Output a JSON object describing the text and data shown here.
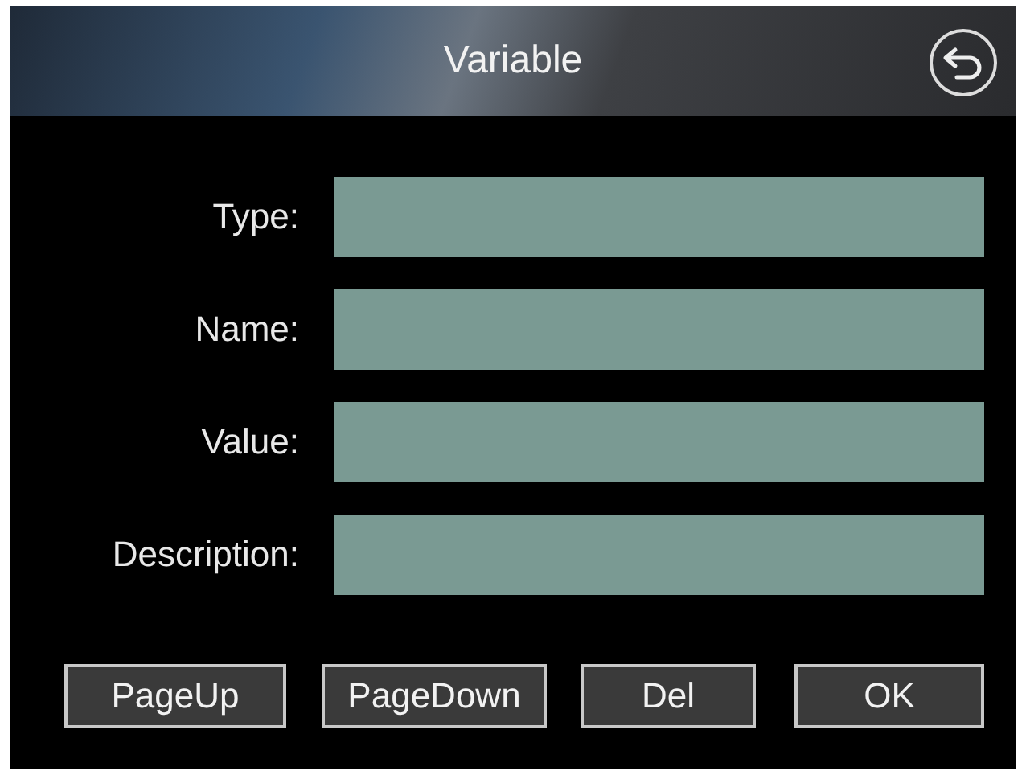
{
  "window": {
    "title": "Variable"
  },
  "fields": [
    {
      "label": "Type:"
    },
    {
      "label": "Name:"
    },
    {
      "label": "Value:"
    },
    {
      "label": "Description:"
    }
  ],
  "buttons": [
    "PageUp",
    "PageDown",
    "Del",
    "OK"
  ]
}
